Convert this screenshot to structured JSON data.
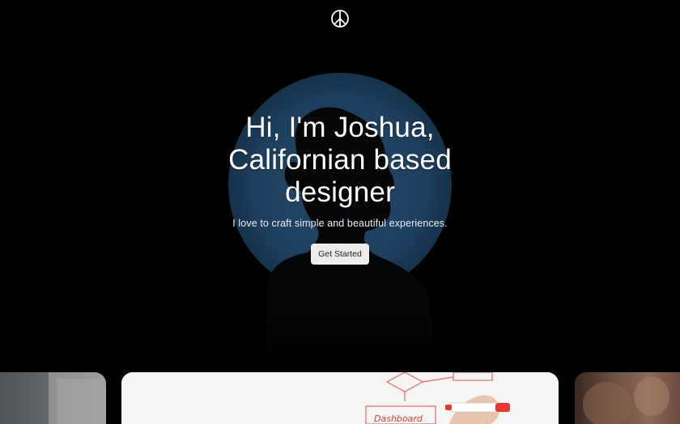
{
  "header": {
    "logo_icon": "peace-sign-icon"
  },
  "hero": {
    "headline_line1": "Hi, I'm Joshua,",
    "headline_line2": "Californian based",
    "headline_line3": "designer",
    "subheadline": "I love to craft simple and beautiful experiences.",
    "cta_label": "Get Started",
    "background": "silhouette-portrait-on-blue-circle",
    "colors": {
      "page_background": "#000000",
      "circle_accent": "#1d3f5e",
      "cta_background": "#ececec",
      "cta_text": "#222222"
    }
  },
  "gallery": {
    "cards": [
      {
        "name": "gallery-card-left",
        "image": "office-photo-partial"
      },
      {
        "name": "gallery-card-main",
        "image": "whiteboard-flowchart-with-marker"
      },
      {
        "name": "gallery-card-right",
        "image": "people-photo-partial"
      }
    ],
    "whiteboard_text": "Dashboard"
  }
}
